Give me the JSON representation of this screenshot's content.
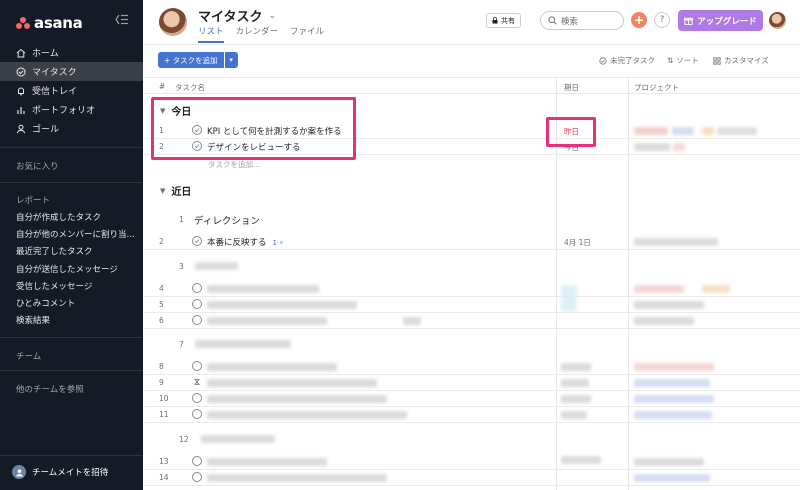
{
  "sidebar": {
    "logo": "asana",
    "nav": [
      {
        "label": "ホーム",
        "icon": "home-icon"
      },
      {
        "label": "マイタスク",
        "icon": "check-circle-icon",
        "active": true
      },
      {
        "label": "受信トレイ",
        "icon": "bell-icon"
      },
      {
        "label": "ポートフォリオ",
        "icon": "bar-chart-icon"
      },
      {
        "label": "ゴール",
        "icon": "person-icon"
      }
    ],
    "favorites_title": "お気に入り",
    "reports_title": "レポート",
    "reports": [
      "自分が作成したタスク",
      "自分が他のメンバーに割り当…",
      "最近完了したタスク",
      "自分が送信したメッセージ",
      "受信したメッセージ",
      "ひとみコメント",
      "検索結果"
    ],
    "teams_title": "チーム",
    "browse_teams": "他のチームを参照",
    "invite_label": "チームメイトを招待"
  },
  "header": {
    "title": "マイタスク",
    "tabs": [
      {
        "label": "リスト",
        "active": true
      },
      {
        "label": "カレンダー"
      },
      {
        "label": "ファイル"
      }
    ],
    "share_label": "共有",
    "search_placeholder": "検索",
    "help_label": "?",
    "upgrade_label": "アップグレード"
  },
  "toolbar": {
    "add_task_label": "+ タスクを追加",
    "incomplete_label": "未完了タスク",
    "sort_label": "ソート",
    "customize_label": "カスタマイズ"
  },
  "table": {
    "columns": {
      "num": "#",
      "name": "タスク名",
      "due": "期日",
      "project": "プロジェクト"
    }
  },
  "sections": {
    "today": {
      "title": "今日",
      "tasks": [
        {
          "num": "1",
          "name": "KPI として何を計測するか案を作る",
          "due": "昨日"
        },
        {
          "num": "2",
          "name": "デザインをレビューする",
          "due": "今日"
        }
      ],
      "add_task_link": "タスクを追加..."
    },
    "soon": {
      "title": "近日",
      "subsection_1": {
        "num": "1",
        "name": "ディレクション"
      },
      "task_2": {
        "num": "2",
        "name": "本番に反映する",
        "subtasks": "1",
        "due": "4月 1日"
      },
      "hidden_row_numbers": [
        "3",
        "4",
        "5",
        "6",
        "7",
        "8",
        "9",
        "10",
        "11",
        "12",
        "13",
        "14"
      ]
    }
  },
  "colors": {
    "sidebar_bg": "#151b26",
    "accent_blue": "#4573d2",
    "highlight": "#e6317a",
    "overdue_red": "#e8384f",
    "upgrade_purple": "#b07ae6",
    "plus_orange": "#f1835f"
  }
}
